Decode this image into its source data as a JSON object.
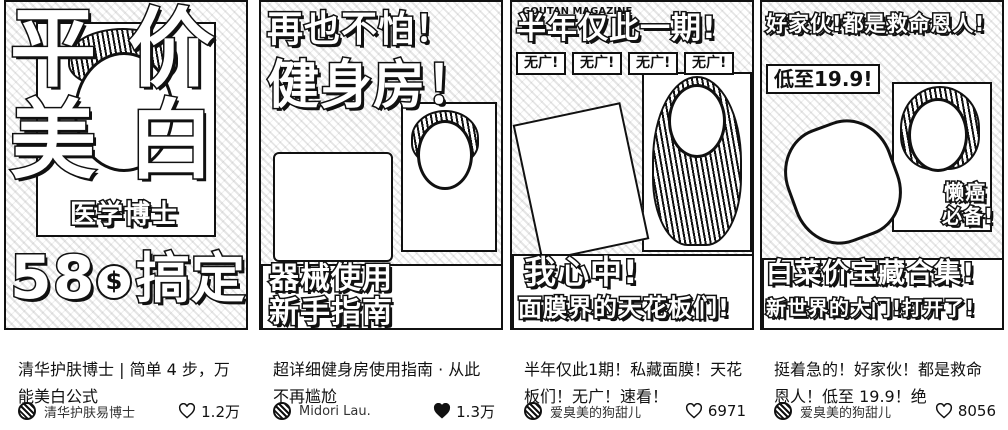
{
  "cards": [
    {
      "cover": {
        "line1": "平  价",
        "line2": "美  白",
        "subtitle": "医学博士",
        "price": "58",
        "dollar": "$",
        "price_suffix": "搞定"
      },
      "title": "清华护肤博士 | 简单 4 步，万能美白公式",
      "author": "清华护肤易博士",
      "likes": "1.2万",
      "liked": false
    },
    {
      "cover": {
        "line1": "再也不怕！",
        "line2": "健身房！",
        "band1": "器械使用",
        "band2": "新手指南"
      },
      "title": "超详细健身房使用指南 · 从此不再尴尬",
      "author": "Midori Lau.",
      "likes": "1.3万",
      "liked": true
    },
    {
      "cover": {
        "magazine": "GOUTAN MAGAZINE",
        "line1": "半年仅此一期!",
        "chips": [
          "无广!",
          "无广!",
          "无广!",
          "无广!"
        ],
        "band1": "我心中!",
        "band2": "面膜界的天花板们!"
      },
      "title": "半年仅此1期！私藏面膜！天花板们！无广！速看！",
      "author": "爱臭美的狗甜儿",
      "likes": "6971",
      "liked": false
    },
    {
      "cover": {
        "line1": "好家伙!都是救命恩人!",
        "price": "低至19.9!",
        "badge1": "懒癌",
        "badge2": "必备!",
        "band1": "白菜价宝藏合集!",
        "band2": "新世界的大门!打开了!"
      },
      "title": "挺着急的！好家伙！都是救命恩人！低至 19.9！绝",
      "author": "爱臭美的狗甜儿",
      "likes": "8056",
      "liked": false
    }
  ]
}
